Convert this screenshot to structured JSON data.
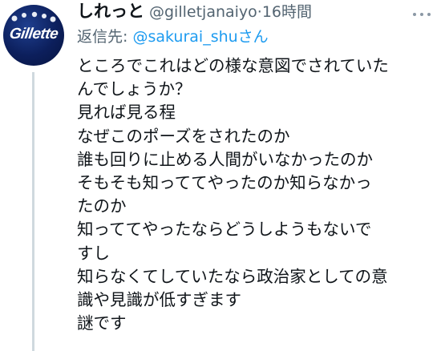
{
  "tweet": {
    "display_name": "しれっと",
    "handle": "@gilletjanaiyo",
    "separator": "·",
    "time": "16時間",
    "reply": {
      "prefix": "返信先: ",
      "target": "@sakurai_shu",
      "suffix": "さん"
    },
    "body_lines": [
      "ところでこれはどの様な意図でされていた",
      "んでしょうか？",
      "見れば見る程",
      "なぜこのポーズをされたのか",
      "誰も回りに止める人間がいなかったのか",
      "そもそも知っててやったのか知らなかっ",
      "たのか",
      "知っててやったならどうしようもないで",
      "すし",
      "知らなくてしていたなら政治家としての意",
      "識や見識が低すぎます",
      "謎です"
    ]
  },
  "avatar": {
    "logo_text": "Gillette",
    "background": "#0c1f5c"
  },
  "icons": {
    "more": "more-horizontal-icon"
  },
  "colors": {
    "link": "#1d9bf0",
    "muted": "#536471",
    "thread_line": "#cfd9de"
  }
}
